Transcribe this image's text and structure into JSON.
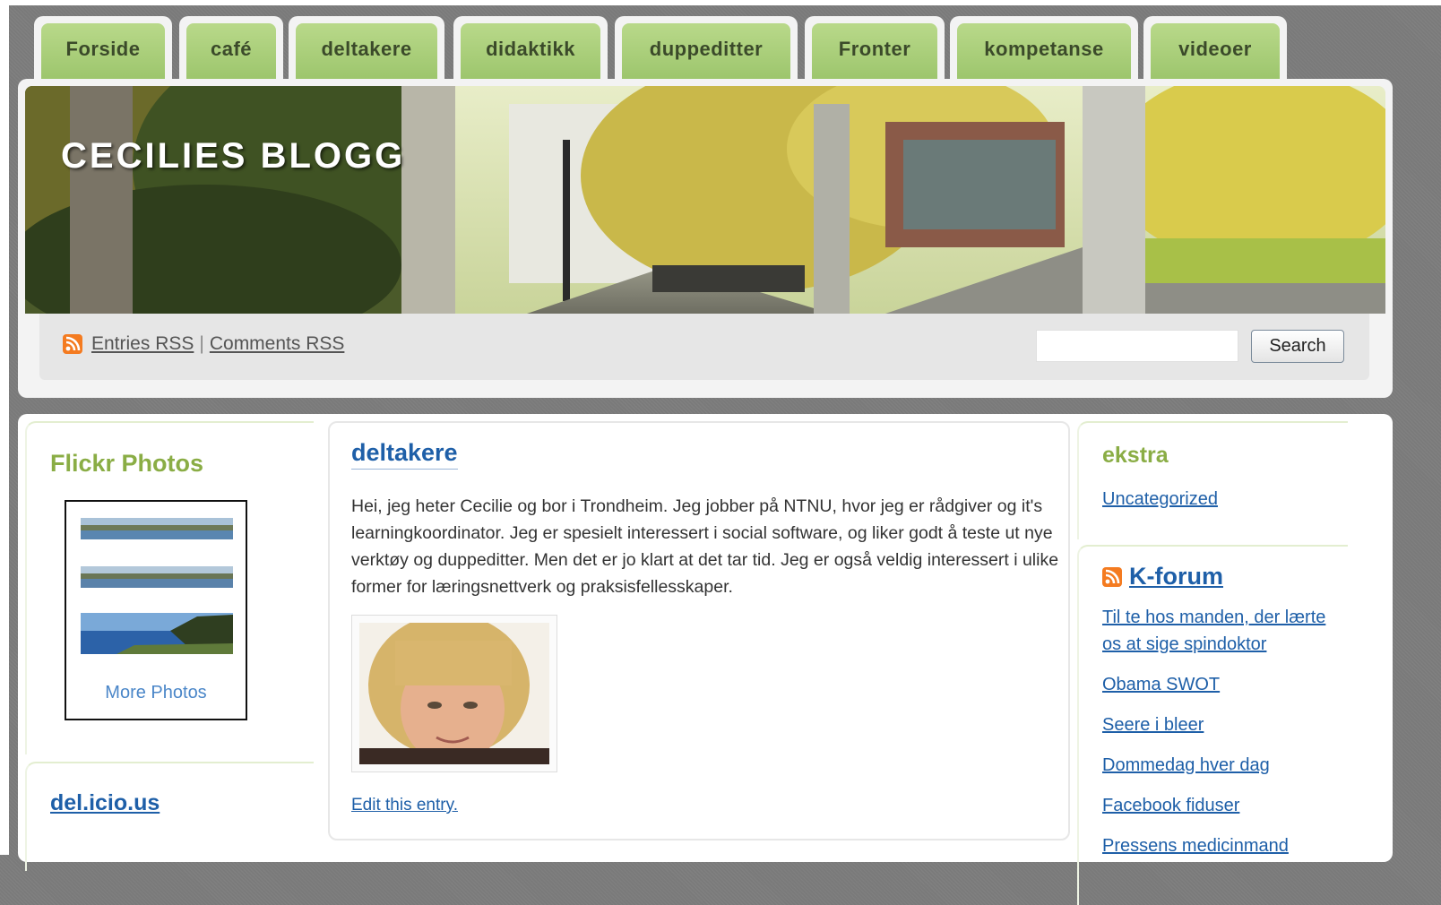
{
  "nav": {
    "tabs": [
      {
        "label": "Forside"
      },
      {
        "label": "café"
      },
      {
        "label": "deltakere"
      },
      {
        "label": "didaktikk"
      },
      {
        "label": "duppeditter"
      },
      {
        "label": "Fronter"
      },
      {
        "label": "kompetanse"
      },
      {
        "label": "videoer"
      }
    ]
  },
  "header": {
    "blog_title": "CECILIES BLOGG",
    "entries_rss": "Entries RSS",
    "separator": "|",
    "comments_rss": "Comments RSS",
    "search_button": "Search",
    "search_value": ""
  },
  "sidebar_left": {
    "flickr_title": "Flickr Photos",
    "more_photos": "More Photos",
    "delicious_title": "del.icio.us"
  },
  "post": {
    "title": "deltakere",
    "body": "Hei,  jeg heter Cecilie og bor i Trondheim. Jeg jobber på NTNU, hvor jeg er rådgiver og it's learningkoordinator. Jeg er spesielt interessert i social software, og liker godt å teste ut nye verktøy og duppeditter. Men det er jo klart at det tar tid. Jeg er også veldig interessert i ulike former for læringsnettverk og praksisfellesskaper.",
    "edit_link": "Edit this entry."
  },
  "sidebar_right": {
    "ekstra_title": "ekstra",
    "category": "Uncategorized",
    "kforum_title": "K-forum",
    "kforum_items": [
      {
        "label": "Til te hos manden, der lærte os at sige spindoktor"
      },
      {
        "label": "Obama SWOT"
      },
      {
        "label": "Seere i bleer"
      },
      {
        "label": "Dommedag hver dag"
      },
      {
        "label": "Facebook fiduser"
      },
      {
        "label": "Pressens medicinmand"
      }
    ]
  },
  "colors": {
    "tab_green": "#a9ce7a",
    "link_blue": "#1e5fa8",
    "heading_green": "#8aad45",
    "rss_orange": "#f47b20"
  }
}
